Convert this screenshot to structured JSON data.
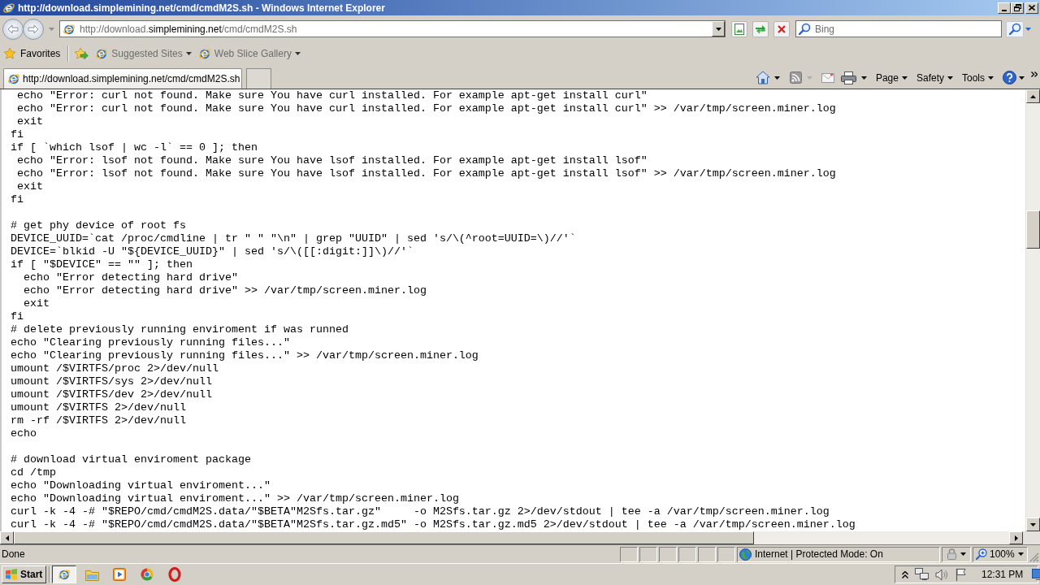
{
  "window": {
    "title": "http://download.simplemining.net/cmd/cmdM2S.sh - Windows Internet Explorer"
  },
  "address_bar": {
    "url_start": "http://download.",
    "url_domain": "simplemining.net",
    "url_end": "/cmd/cmdM2S.sh"
  },
  "search": {
    "placeholder": "Bing"
  },
  "favorites_bar": {
    "label": "Favorites",
    "items": [
      {
        "label": "Suggested Sites"
      },
      {
        "label": "Web Slice Gallery"
      }
    ]
  },
  "tabs": [
    {
      "label": "http://download.simplemining.net/cmd/cmdM2S.sh",
      "selected": true
    }
  ],
  "command_bar": {
    "menus": [
      "Page",
      "Safety",
      "Tools"
    ]
  },
  "code_blocks": [
    [
      " echo \"Error: curl not found. Make sure You have curl installed. For example apt-get install curl\"",
      " echo \"Error: curl not found. Make sure You have curl installed. For example apt-get install curl\" >> /var/tmp/screen.miner.log",
      " exit",
      "fi",
      "if [ `which lsof | wc -l` == 0 ]; then",
      " echo \"Error: lsof not found. Make sure You have lsof installed. For example apt-get install lsof\"",
      " echo \"Error: lsof not found. Make sure You have lsof installed. For example apt-get install lsof\" >> /var/tmp/screen.miner.log",
      " exit",
      "fi"
    ],
    [
      "# get phy device of root fs",
      "DEVICE_UUID=`cat /proc/cmdline | tr \" \" \"\\n\" | grep \"UUID\" | sed 's/\\(^root=UUID=\\)//'`",
      "DEVICE=`blkid -U \"${DEVICE_UUID}\" | sed 's/\\([[:digit:]]\\)//'`",
      "if [ \"$DEVICE\" == \"\" ]; then",
      "  echo \"Error detecting hard drive\"",
      "  echo \"Error detecting hard drive\" >> /var/tmp/screen.miner.log",
      "  exit",
      "fi",
      "# delete previously running enviroment if was runned",
      "echo \"Clearing previously running files...\"",
      "echo \"Clearing previously running files...\" >> /var/tmp/screen.miner.log",
      "umount /$VIRTFS/proc 2>/dev/null",
      "umount /$VIRTFS/sys 2>/dev/null",
      "umount /$VIRTFS/dev 2>/dev/null",
      "umount /$VIRTFS 2>/dev/null",
      "rm -rf /$VIRTFS 2>/dev/null",
      "echo"
    ],
    [
      "# download virtual enviroment package",
      "cd /tmp",
      "echo \"Downloading virtual enviroment...\"",
      "echo \"Downloading virtual enviroment...\" >> /var/tmp/screen.miner.log",
      "curl -k -4 -# \"$REPO/cmd/cmdM2S.data/\"$BETA\"M2Sfs.tar.gz\"     -o M2Sfs.tar.gz 2>/dev/stdout | tee -a /var/tmp/screen.miner.log",
      "curl -k -4 -# \"$REPO/cmd/cmdM2S.data/\"$BETA\"M2Sfs.tar.gz.md5\" -o M2Sfs.tar.gz.md5 2>/dev/stdout | tee -a /var/tmp/screen.miner.log"
    ]
  ],
  "status_bar": {
    "text": "Done",
    "zone": "Internet | Protected Mode: On",
    "zoom": "100%"
  },
  "taskbar": {
    "start": "Start",
    "apps": [
      {
        "selected": true
      },
      {
        "selected": false
      },
      {
        "selected": false
      },
      {
        "selected": false
      },
      {
        "selected": false
      }
    ],
    "clock": "12:31 PM"
  }
}
